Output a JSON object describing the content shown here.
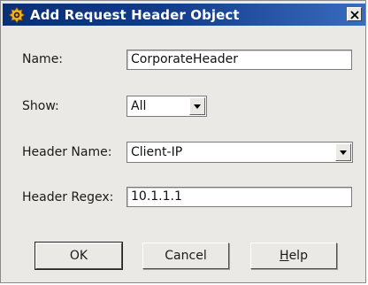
{
  "window": {
    "title": "Add Request Header Object",
    "icon": "gold-badge-icon",
    "close_glyph": "×"
  },
  "form": {
    "name": {
      "label": "Name:",
      "value": "CorporateHeader"
    },
    "show": {
      "label": "Show:",
      "value": "All"
    },
    "header_name": {
      "label": "Header Name:",
      "value": "Client-IP"
    },
    "header_regex": {
      "label": "Header Regex:",
      "value": "10.1.1.1"
    }
  },
  "buttons": {
    "ok": "OK",
    "cancel": "Cancel",
    "help_mnemonic": "H",
    "help_rest": "elp"
  },
  "colors": {
    "titlebar_start": "#0a2f75",
    "titlebar_end": "#3a6bbf",
    "dialog_bg": "#ebe9e6",
    "icon_gold": "#f2b21f"
  }
}
